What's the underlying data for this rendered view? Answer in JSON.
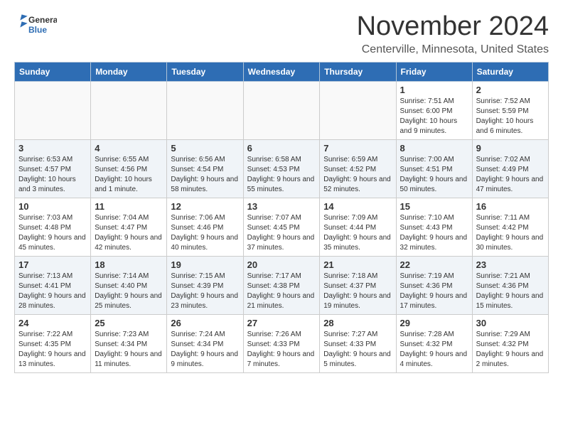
{
  "header": {
    "logo_general": "General",
    "logo_blue": "Blue",
    "month_title": "November 2024",
    "location": "Centerville, Minnesota, United States"
  },
  "days_of_week": [
    "Sunday",
    "Monday",
    "Tuesday",
    "Wednesday",
    "Thursday",
    "Friday",
    "Saturday"
  ],
  "weeks": [
    [
      {
        "day": "",
        "info": ""
      },
      {
        "day": "",
        "info": ""
      },
      {
        "day": "",
        "info": ""
      },
      {
        "day": "",
        "info": ""
      },
      {
        "day": "",
        "info": ""
      },
      {
        "day": "1",
        "info": "Sunrise: 7:51 AM\nSunset: 6:00 PM\nDaylight: 10 hours and 9 minutes."
      },
      {
        "day": "2",
        "info": "Sunrise: 7:52 AM\nSunset: 5:59 PM\nDaylight: 10 hours and 6 minutes."
      }
    ],
    [
      {
        "day": "3",
        "info": "Sunrise: 6:53 AM\nSunset: 4:57 PM\nDaylight: 10 hours and 3 minutes."
      },
      {
        "day": "4",
        "info": "Sunrise: 6:55 AM\nSunset: 4:56 PM\nDaylight: 10 hours and 1 minute."
      },
      {
        "day": "5",
        "info": "Sunrise: 6:56 AM\nSunset: 4:54 PM\nDaylight: 9 hours and 58 minutes."
      },
      {
        "day": "6",
        "info": "Sunrise: 6:58 AM\nSunset: 4:53 PM\nDaylight: 9 hours and 55 minutes."
      },
      {
        "day": "7",
        "info": "Sunrise: 6:59 AM\nSunset: 4:52 PM\nDaylight: 9 hours and 52 minutes."
      },
      {
        "day": "8",
        "info": "Sunrise: 7:00 AM\nSunset: 4:51 PM\nDaylight: 9 hours and 50 minutes."
      },
      {
        "day": "9",
        "info": "Sunrise: 7:02 AM\nSunset: 4:49 PM\nDaylight: 9 hours and 47 minutes."
      }
    ],
    [
      {
        "day": "10",
        "info": "Sunrise: 7:03 AM\nSunset: 4:48 PM\nDaylight: 9 hours and 45 minutes."
      },
      {
        "day": "11",
        "info": "Sunrise: 7:04 AM\nSunset: 4:47 PM\nDaylight: 9 hours and 42 minutes."
      },
      {
        "day": "12",
        "info": "Sunrise: 7:06 AM\nSunset: 4:46 PM\nDaylight: 9 hours and 40 minutes."
      },
      {
        "day": "13",
        "info": "Sunrise: 7:07 AM\nSunset: 4:45 PM\nDaylight: 9 hours and 37 minutes."
      },
      {
        "day": "14",
        "info": "Sunrise: 7:09 AM\nSunset: 4:44 PM\nDaylight: 9 hours and 35 minutes."
      },
      {
        "day": "15",
        "info": "Sunrise: 7:10 AM\nSunset: 4:43 PM\nDaylight: 9 hours and 32 minutes."
      },
      {
        "day": "16",
        "info": "Sunrise: 7:11 AM\nSunset: 4:42 PM\nDaylight: 9 hours and 30 minutes."
      }
    ],
    [
      {
        "day": "17",
        "info": "Sunrise: 7:13 AM\nSunset: 4:41 PM\nDaylight: 9 hours and 28 minutes."
      },
      {
        "day": "18",
        "info": "Sunrise: 7:14 AM\nSunset: 4:40 PM\nDaylight: 9 hours and 25 minutes."
      },
      {
        "day": "19",
        "info": "Sunrise: 7:15 AM\nSunset: 4:39 PM\nDaylight: 9 hours and 23 minutes."
      },
      {
        "day": "20",
        "info": "Sunrise: 7:17 AM\nSunset: 4:38 PM\nDaylight: 9 hours and 21 minutes."
      },
      {
        "day": "21",
        "info": "Sunrise: 7:18 AM\nSunset: 4:37 PM\nDaylight: 9 hours and 19 minutes."
      },
      {
        "day": "22",
        "info": "Sunrise: 7:19 AM\nSunset: 4:36 PM\nDaylight: 9 hours and 17 minutes."
      },
      {
        "day": "23",
        "info": "Sunrise: 7:21 AM\nSunset: 4:36 PM\nDaylight: 9 hours and 15 minutes."
      }
    ],
    [
      {
        "day": "24",
        "info": "Sunrise: 7:22 AM\nSunset: 4:35 PM\nDaylight: 9 hours and 13 minutes."
      },
      {
        "day": "25",
        "info": "Sunrise: 7:23 AM\nSunset: 4:34 PM\nDaylight: 9 hours and 11 minutes."
      },
      {
        "day": "26",
        "info": "Sunrise: 7:24 AM\nSunset: 4:34 PM\nDaylight: 9 hours and 9 minutes."
      },
      {
        "day": "27",
        "info": "Sunrise: 7:26 AM\nSunset: 4:33 PM\nDaylight: 9 hours and 7 minutes."
      },
      {
        "day": "28",
        "info": "Sunrise: 7:27 AM\nSunset: 4:33 PM\nDaylight: 9 hours and 5 minutes."
      },
      {
        "day": "29",
        "info": "Sunrise: 7:28 AM\nSunset: 4:32 PM\nDaylight: 9 hours and 4 minutes."
      },
      {
        "day": "30",
        "info": "Sunrise: 7:29 AM\nSunset: 4:32 PM\nDaylight: 9 hours and 2 minutes."
      }
    ]
  ]
}
